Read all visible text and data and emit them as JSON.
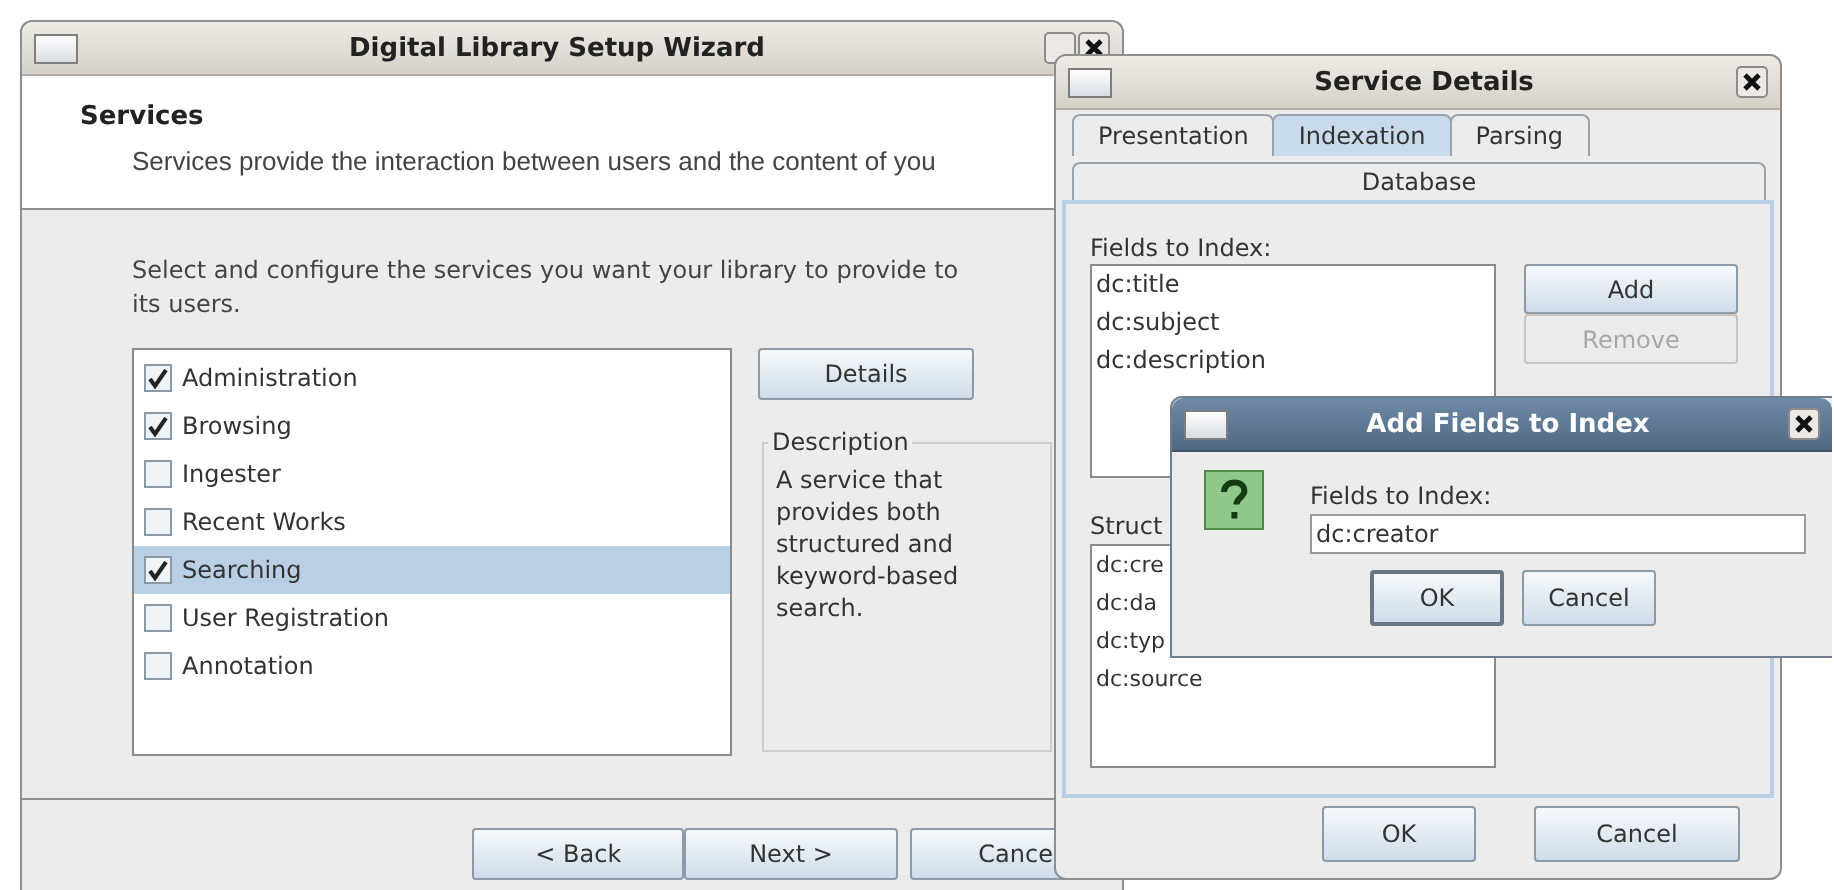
{
  "wizard": {
    "title": "Digital Library Setup Wizard",
    "heading": "Services",
    "subtitle": "Services provide the interaction between users and the content of you",
    "instructions": "Select and configure the services you want your library to provide to its users.",
    "services": [
      {
        "label": "Administration",
        "checked": true,
        "selected": false
      },
      {
        "label": "Browsing",
        "checked": true,
        "selected": false
      },
      {
        "label": "Ingester",
        "checked": false,
        "selected": false
      },
      {
        "label": "Recent Works",
        "checked": false,
        "selected": false
      },
      {
        "label": "Searching",
        "checked": true,
        "selected": true
      },
      {
        "label": "User Registration",
        "checked": false,
        "selected": false
      },
      {
        "label": "Annotation",
        "checked": false,
        "selected": false
      }
    ],
    "details_button": "Details",
    "description": {
      "title": "Description",
      "text": "A service that provides both structured and keyword-based search."
    },
    "buttons": [
      "< Back",
      "Next >",
      "Cance"
    ]
  },
  "service_details": {
    "title": "Service Details",
    "tabs": [
      {
        "label": "Presentation",
        "selected": false
      },
      {
        "label": "Indexation",
        "selected": true
      },
      {
        "label": "Parsing",
        "selected": false
      },
      {
        "label": "Database",
        "selected": false
      }
    ],
    "fields_label": "Fields to Index:",
    "fields": [
      "dc:title",
      "dc:subject",
      "dc:description"
    ],
    "add_button": {
      "label": "Add",
      "disabled": false
    },
    "remove_button": {
      "label": "Remove",
      "disabled": true
    },
    "structured_label": "Struct",
    "structured_fields": [
      "dc:cre",
      "dc:da",
      "dc:typ",
      "dc:source"
    ],
    "buttons": [
      "OK",
      "Cancel"
    ]
  },
  "add_dialog": {
    "title": "Add Fields to Index",
    "label": "Fields to Index:",
    "value": "dc:creator",
    "buttons": [
      {
        "label": "OK",
        "focused": true
      },
      {
        "label": "Cancel",
        "focused": false
      }
    ]
  }
}
